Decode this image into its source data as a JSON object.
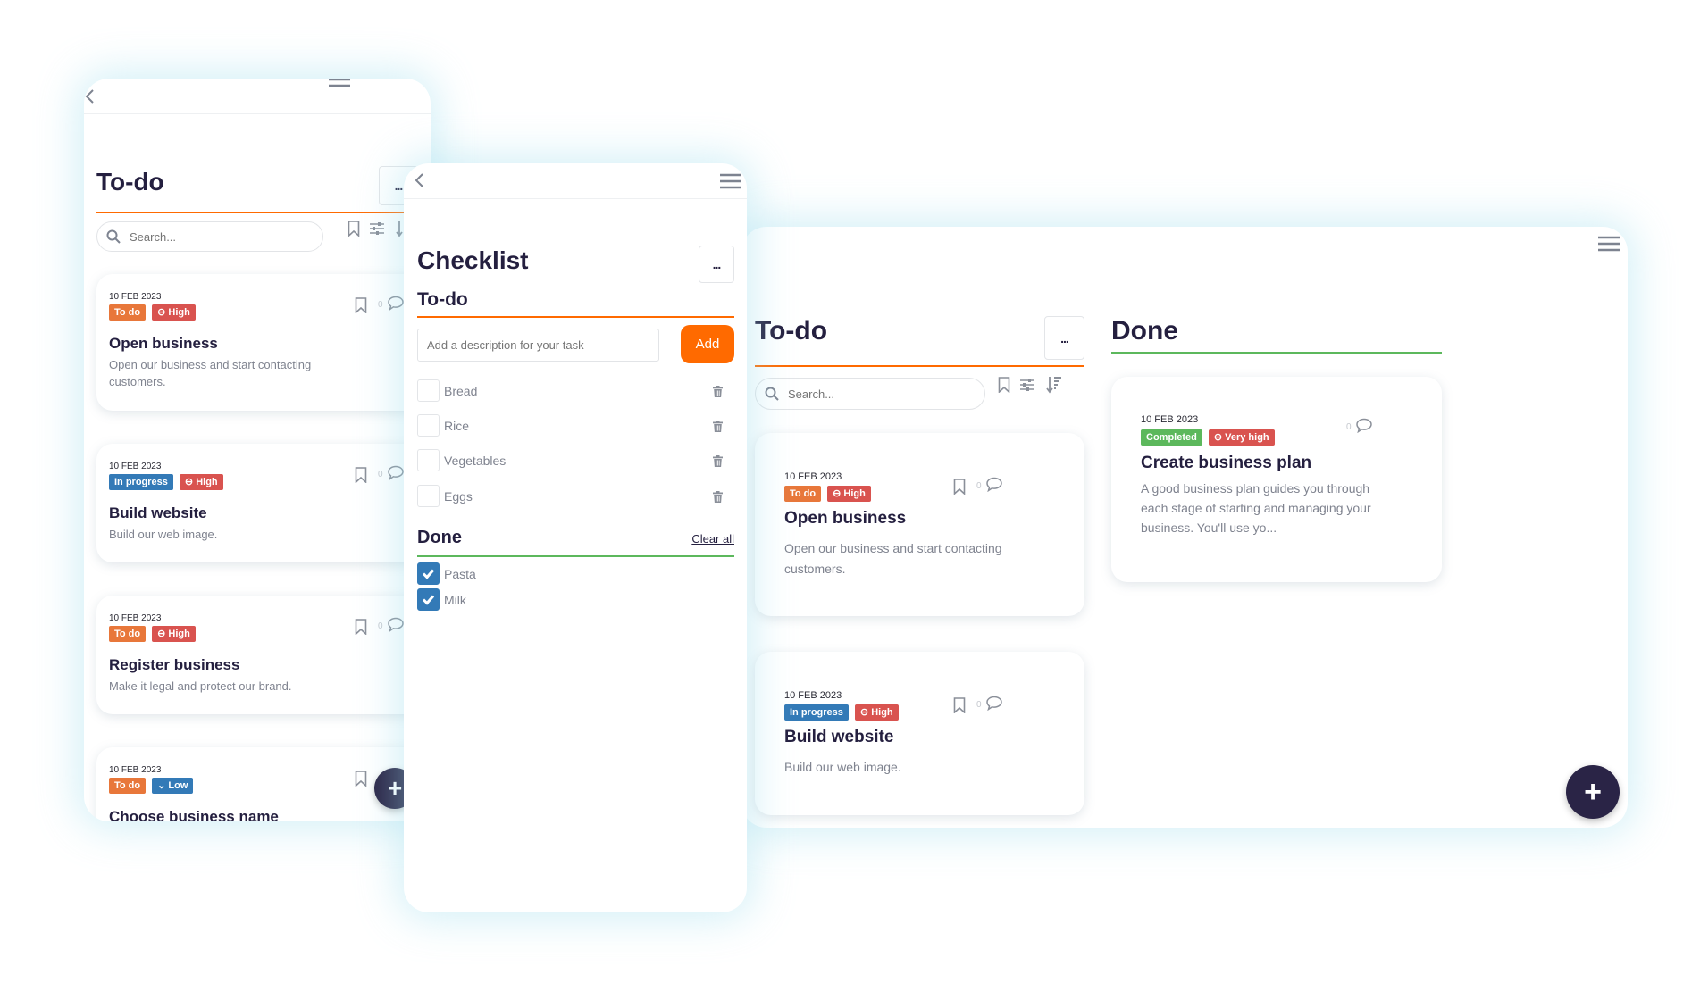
{
  "colors": {
    "accent": "#ff6a00",
    "done": "#5cb85c",
    "todo_badge": "#e8773a",
    "high_badge": "#d9534f",
    "progress_badge": "#337ab7",
    "fab": "#2a2446"
  },
  "icons": {
    "back": "chevron-left-icon",
    "menu": "hamburger-menu-icon",
    "search": "search-icon",
    "bookmark": "bookmark-icon",
    "filter": "sliders-icon",
    "sort": "sort-icon",
    "comment": "comment-icon",
    "trash": "trash-icon",
    "add": "plus-icon",
    "check": "checkmark-icon"
  },
  "mobile": {
    "title": "To-do",
    "more_label": "...",
    "search": {
      "placeholder": "Search..."
    },
    "cards": [
      {
        "date": "10 FEB 2023",
        "status": "To do",
        "priority": "High",
        "title": "Open business",
        "desc": "Open our business and start contacting customers.",
        "comments": "0"
      },
      {
        "date": "10 FEB 2023",
        "status": "In progress",
        "priority": "High",
        "title": "Build website",
        "desc": "Build our web image.",
        "comments": "0"
      },
      {
        "date": "10 FEB 2023",
        "status": "To do",
        "priority": "High",
        "title": "Register business",
        "desc": "Make it legal and protect our brand.",
        "comments": "0"
      },
      {
        "date": "10 FEB 2023",
        "status": "To do",
        "priority": "Low",
        "title": "Choose business name",
        "desc": "",
        "comments": ""
      }
    ],
    "fab_label": "+"
  },
  "checklist": {
    "title": "Checklist",
    "more_label": "...",
    "todo_heading": "To-do",
    "input": {
      "placeholder": "Add a description for your task",
      "value": ""
    },
    "add_label": "Add",
    "todo_items": [
      {
        "label": "Bread"
      },
      {
        "label": "Rice"
      },
      {
        "label": "Vegetables"
      },
      {
        "label": "Eggs"
      }
    ],
    "done_heading": "Done",
    "clear_all": "Clear all",
    "done_items": [
      {
        "label": "Pasta",
        "checked": true
      },
      {
        "label": "Milk",
        "checked": true
      }
    ]
  },
  "board": {
    "todo": {
      "title": "To-do",
      "more_label": "...",
      "search": {
        "placeholder": "Search..."
      },
      "cards": [
        {
          "date": "10 FEB 2023",
          "status": "To do",
          "priority": "High",
          "title": "Open business",
          "desc": "Open our business and start contacting customers.",
          "comments": "0"
        },
        {
          "date": "10 FEB 2023",
          "status": "In progress",
          "priority": "High",
          "title": "Build website",
          "desc": "Build our web image.",
          "comments": "0"
        }
      ]
    },
    "done": {
      "title": "Done",
      "cards": [
        {
          "date": "10 FEB 2023",
          "status": "Completed",
          "priority": "Very high",
          "title": "Create business plan",
          "desc": "A good business plan guides you through each stage of starting and managing your business. You'll use yo...",
          "comments": "0"
        }
      ]
    },
    "fab_label": "+"
  }
}
